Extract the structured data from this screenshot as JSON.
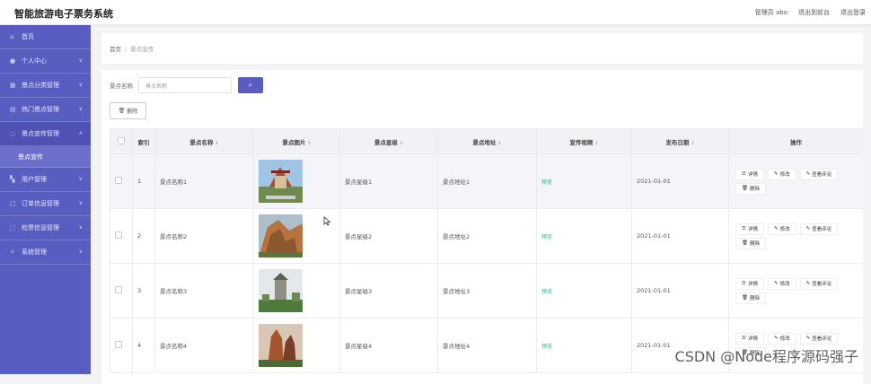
{
  "app": {
    "title": "智能旅游电子票务系统"
  },
  "topbar": {
    "user_label": "管理员 abo",
    "console_link": "退出到前台",
    "logout_link": "退出登录"
  },
  "sidebar": {
    "items": [
      {
        "label": "首页",
        "icon": "home-icon"
      },
      {
        "label": "个人中心",
        "icon": "user-icon"
      },
      {
        "label": "景点分类管理",
        "icon": "grid-icon"
      },
      {
        "label": "热门景点管理",
        "icon": "folder-icon"
      },
      {
        "label": "景点宣传管理",
        "icon": "circle-icon"
      },
      {
        "label": "用户管理",
        "icon": "users-icon"
      },
      {
        "label": "订单信息管理",
        "icon": "doc-icon"
      },
      {
        "label": "检票信息管理",
        "icon": "ticket-icon"
      },
      {
        "label": "系统管理",
        "icon": "gear-icon"
      }
    ],
    "sub_item": "景点宣传"
  },
  "breadcrumb": {
    "home": "首页",
    "separator": "/",
    "current": "景点宣传"
  },
  "search": {
    "label": "景点名称",
    "placeholder": "景点名称",
    "button_icon": "search-icon"
  },
  "toolbar": {
    "delete_label": "删除"
  },
  "table": {
    "headers": {
      "index": "索引",
      "name": "景点名称",
      "image": "景点图片",
      "level": "景点星级",
      "address": "景点地址",
      "video": "宣传视频",
      "date": "发布日期",
      "actions": "操作"
    },
    "rows": [
      {
        "index": "1",
        "name": "景点名称1",
        "level": "景点星级1",
        "address": "景点地址1",
        "video": "预览",
        "date": "2021-01-01"
      },
      {
        "index": "2",
        "name": "景点名称2",
        "level": "景点星级2",
        "address": "景点地址2",
        "video": "预览",
        "date": "2021-01-01"
      },
      {
        "index": "3",
        "name": "景点名称3",
        "level": "景点星级3",
        "address": "景点地址3",
        "video": "预览",
        "date": "2021-01-01"
      },
      {
        "index": "4",
        "name": "景点名称4",
        "level": "景点星级4",
        "address": "景点地址4",
        "video": "预览",
        "date": "2021-01-01"
      }
    ],
    "actions": {
      "detail": "详情",
      "edit": "修改",
      "comments": "查看评论",
      "delete": "删除"
    }
  },
  "watermark": "CSDN @Node程序源码强子",
  "colors": {
    "sidebar": "#5a5dc0",
    "accent": "#5a5dc0",
    "video_link": "#2ab57d"
  }
}
